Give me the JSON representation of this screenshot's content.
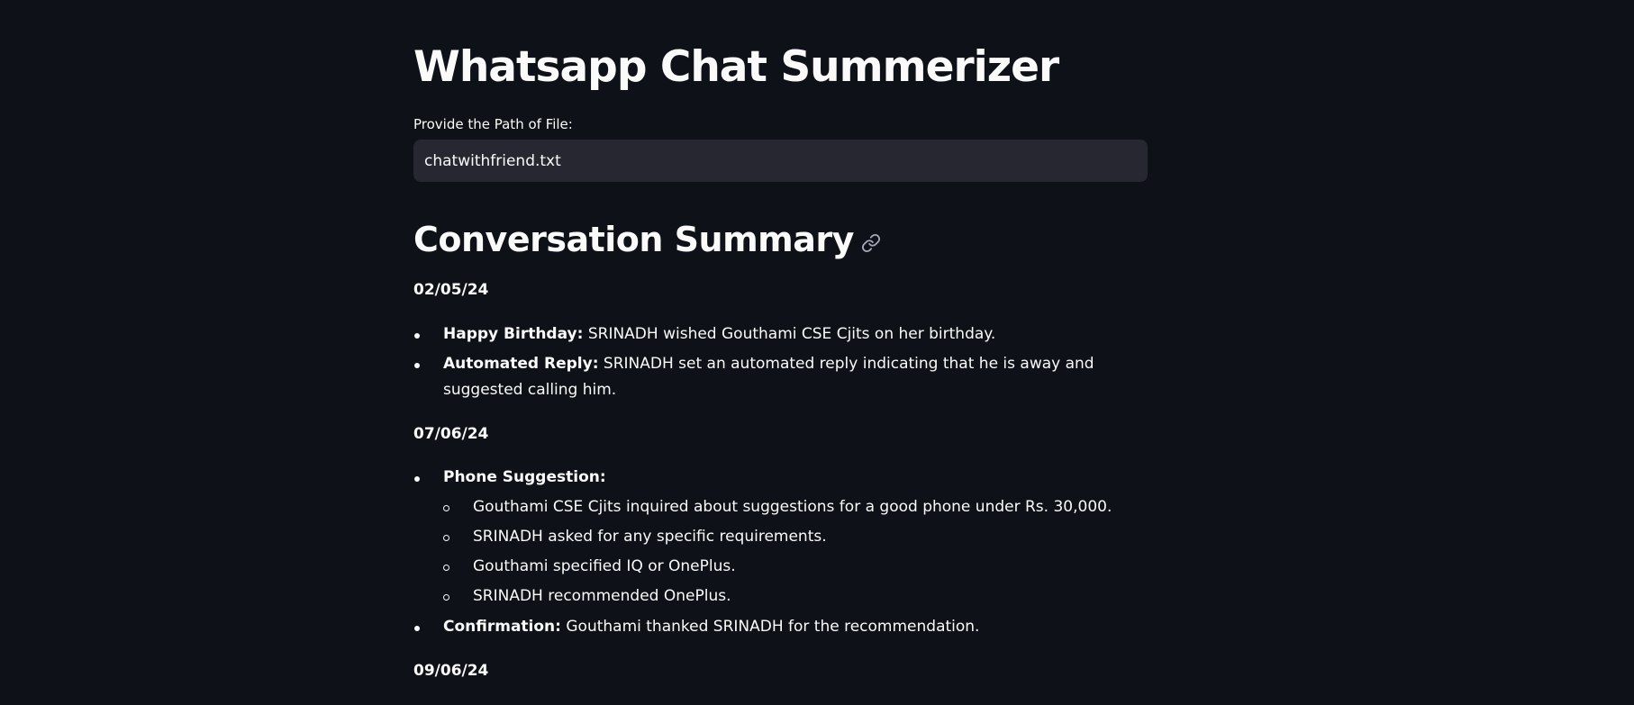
{
  "app": {
    "title": "Whatsapp Chat Summerizer"
  },
  "file_input": {
    "label": "Provide the Path of File:",
    "value": "chatwithfriend.txt"
  },
  "summary": {
    "title": "Conversation Summary",
    "anchor_icon": "link-icon",
    "sections": [
      {
        "date": "02/05/24",
        "items": [
          {
            "label": "Happy Birthday:",
            "text": " SRINADH wished Gouthami CSE Cjits on her birthday."
          },
          {
            "label": "Automated Reply:",
            "text": " SRINADH set an automated reply indicating that he is away and suggested calling him."
          }
        ]
      },
      {
        "date": "07/06/24",
        "items": [
          {
            "label": "Phone Suggestion:",
            "text": ""
          },
          {
            "label": "",
            "text": "Gouthami CSE Cjits inquired about suggestions for a good phone under Rs. 30,000."
          },
          {
            "label": "",
            "text": "SRINADH asked for any specific requirements."
          },
          {
            "label": "",
            "text": "Gouthami specified IQ or OnePlus."
          },
          {
            "label": "",
            "text": "SRINADH recommended OnePlus."
          },
          {
            "label": "Confirmation:",
            "text": " Gouthami thanked SRINADH for the recommendation."
          }
        ]
      },
      {
        "date": "09/06/24",
        "items": []
      }
    ]
  },
  "colors": {
    "background": "#0e1117",
    "text": "#fafafa",
    "input_background": "#262730"
  }
}
